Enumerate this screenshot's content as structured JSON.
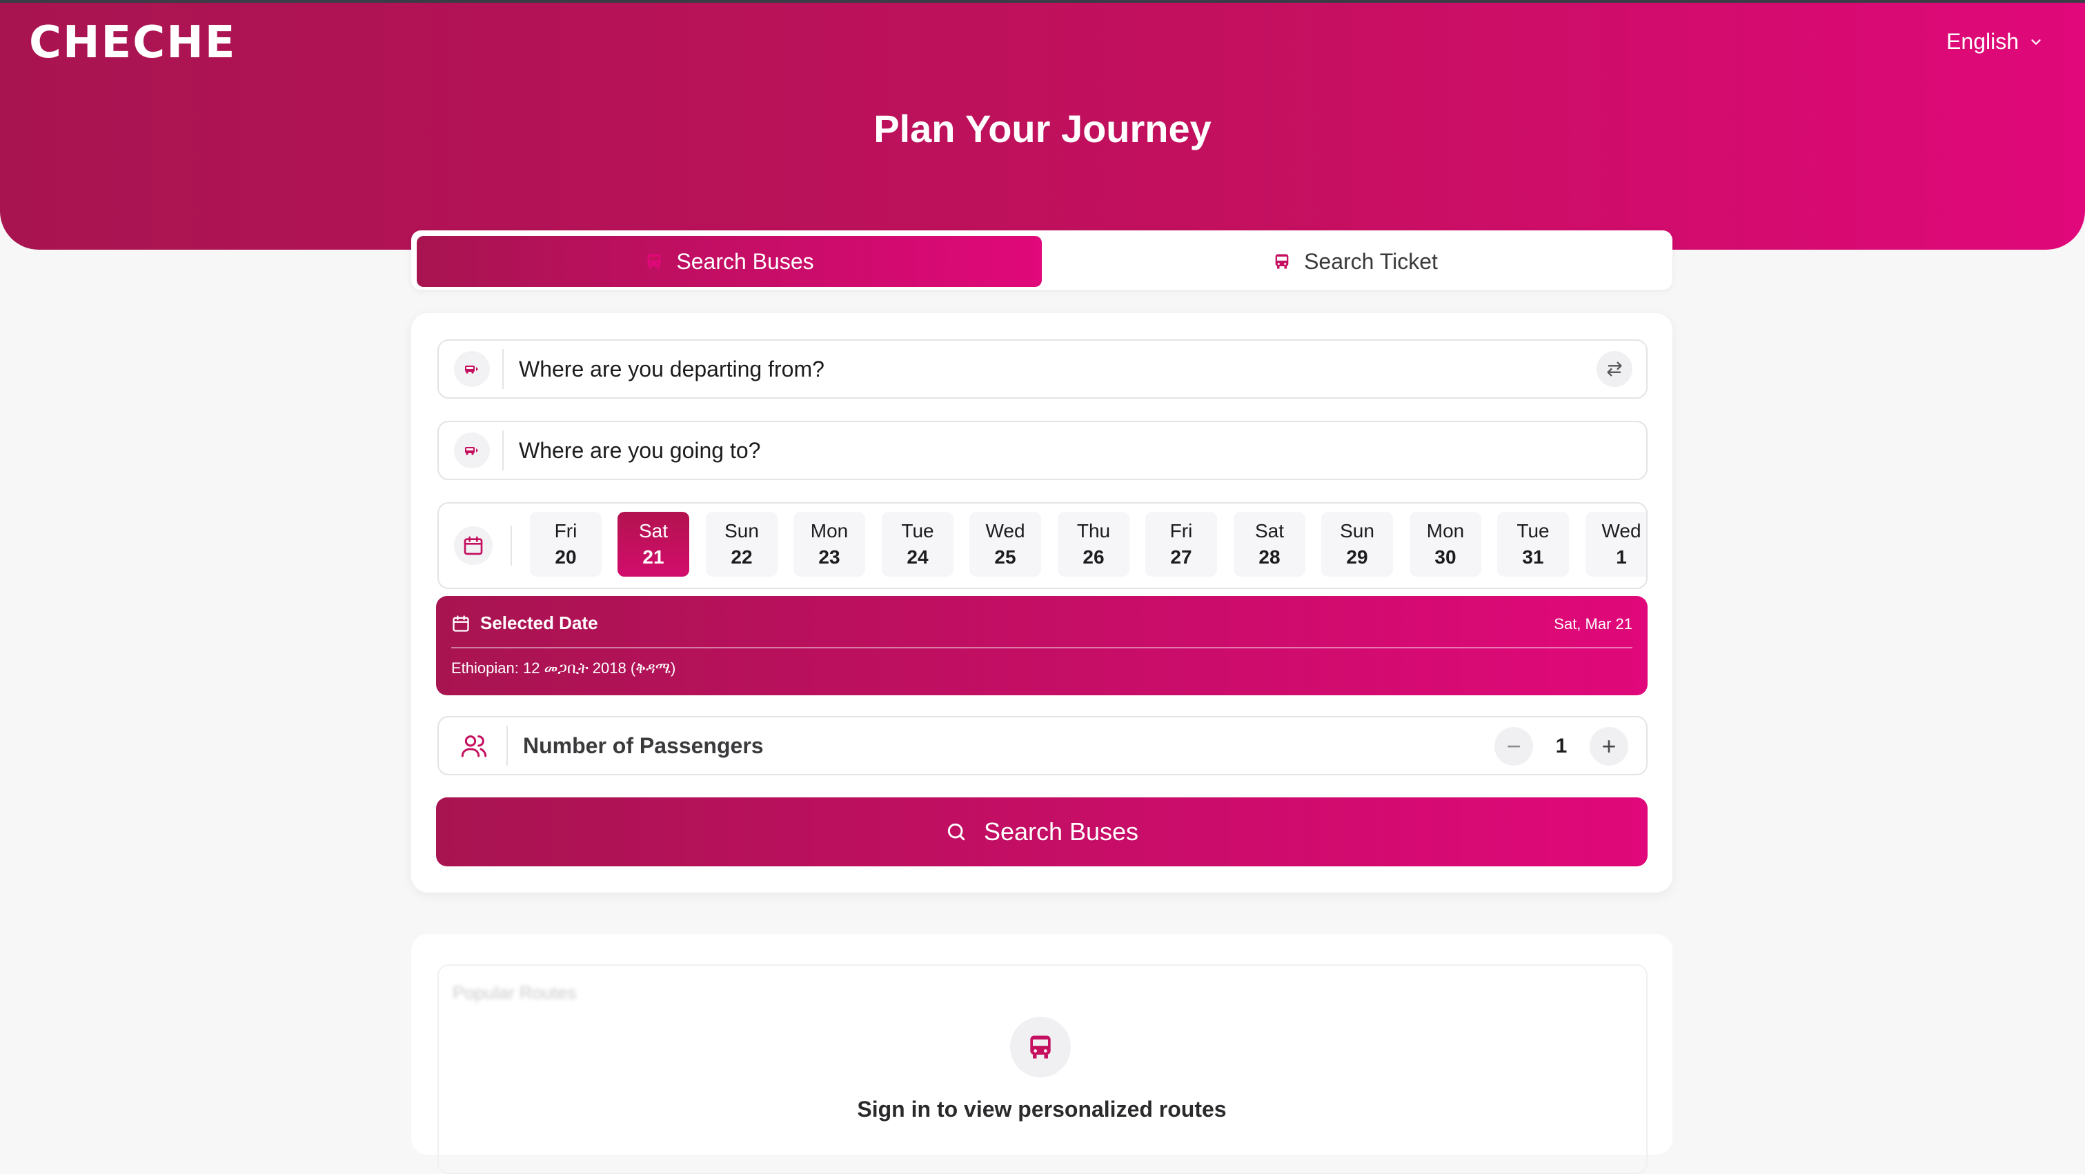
{
  "brand": {
    "logo": "CHECHE",
    "language": "English"
  },
  "hero": {
    "title": "Plan Your Journey"
  },
  "tabs": {
    "search_buses": "Search Buses",
    "search_ticket": "Search Ticket"
  },
  "form": {
    "from_placeholder": "Where are you departing from?",
    "to_placeholder": "Where are you going to?"
  },
  "dates": [
    {
      "day": "Fri",
      "num": "20"
    },
    {
      "day": "Sat",
      "num": "21",
      "selected": true
    },
    {
      "day": "Sun",
      "num": "22"
    },
    {
      "day": "Mon",
      "num": "23"
    },
    {
      "day": "Tue",
      "num": "24"
    },
    {
      "day": "Wed",
      "num": "25"
    },
    {
      "day": "Thu",
      "num": "26"
    },
    {
      "day": "Fri",
      "num": "27"
    },
    {
      "day": "Sat",
      "num": "28"
    },
    {
      "day": "Sun",
      "num": "29"
    },
    {
      "day": "Mon",
      "num": "30"
    },
    {
      "day": "Tue",
      "num": "31"
    },
    {
      "day": "Wed",
      "num": "1"
    }
  ],
  "selected_date": {
    "label": "Selected Date",
    "date": "Sat, Mar 21",
    "ethiopian": "Ethiopian: 12 መጋቢት 2018 (ቅዳሜ)"
  },
  "passengers": {
    "label": "Number of Passengers",
    "count": "1",
    "minus": "−",
    "plus": "+"
  },
  "search_button": "Search Buses",
  "popular": {
    "title": "Popular Routes",
    "signin": "Sign in to view personalized routes"
  },
  "colors": {
    "accent_start": "#a81450",
    "accent_end": "#e0087a"
  }
}
